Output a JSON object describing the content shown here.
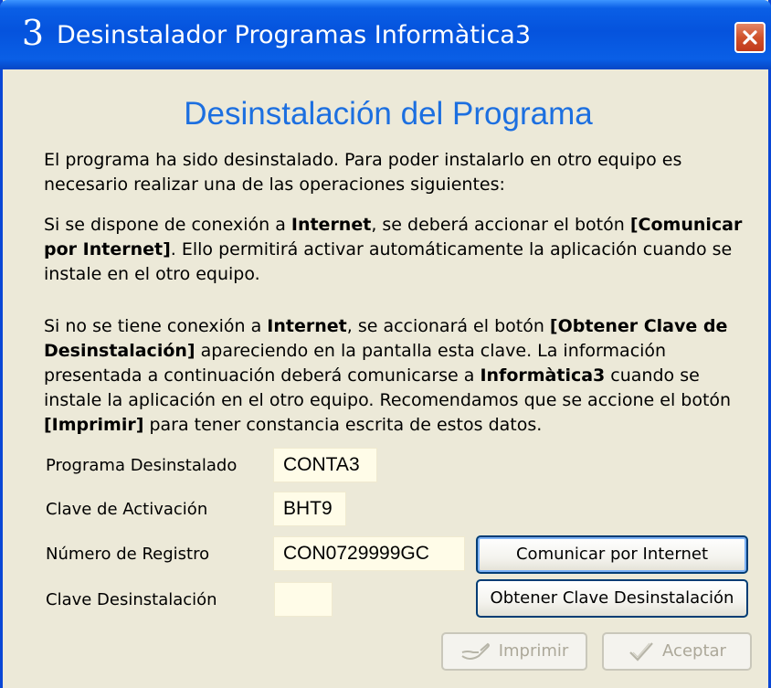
{
  "window": {
    "title": "Desinstalador Programas Informàtica3",
    "app_icon_glyph": "3",
    "close_icon": "close-icon"
  },
  "heading": "Desinstalación del Programa",
  "paragraphs": {
    "p1": "El programa ha sido desinstalado. Para poder instalarlo en otro equipo es necesario realizar una de las operaciones siguientes:",
    "p2_a": "Si se dispone de conexión a ",
    "p2_b": "Internet",
    "p2_c": ", se deberá accionar el botón ",
    "p2_d": "[Comunicar por Internet]",
    "p2_e": ". Ello permitirá activar automáticamente la aplicación cuando se instale en el otro equipo.",
    "p3_a": "Si no se tiene conexión a ",
    "p3_b": "Internet",
    "p3_c": ", se accionará el botón ",
    "p3_d": "[Obtener Clave de Desinstalación]",
    "p3_e": " apareciendo en la pantalla esta clave. La información presentada a continuación deberá comunicarse a ",
    "p3_f": "Informàtica3",
    "p3_g": " cuando se instale la aplicación en el otro equipo. Recomendamos que se accione el botón ",
    "p3_h": "[Imprimir]",
    "p3_i": " para tener constancia escrita de estos datos."
  },
  "fields": {
    "programa_label": "Programa Desinstalado",
    "programa_value": "CONTA3",
    "activacion_label": "Clave de Activación",
    "activacion_value": "BHT9",
    "registro_label": "Número de Registro",
    "registro_value": "CON0729999GC",
    "desinstalacion_label": "Clave Desinstalación",
    "desinstalacion_value": ""
  },
  "buttons": {
    "comunicar": "Comunicar por Internet",
    "obtener": "Obtener Clave Desinstalación",
    "imprimir": "Imprimir",
    "aceptar": "Aceptar"
  },
  "colors": {
    "titlebar": "#0553dd",
    "heading": "#1c6fe0",
    "window_bg": "#ece9d8",
    "field_bg": "#fffce8"
  }
}
